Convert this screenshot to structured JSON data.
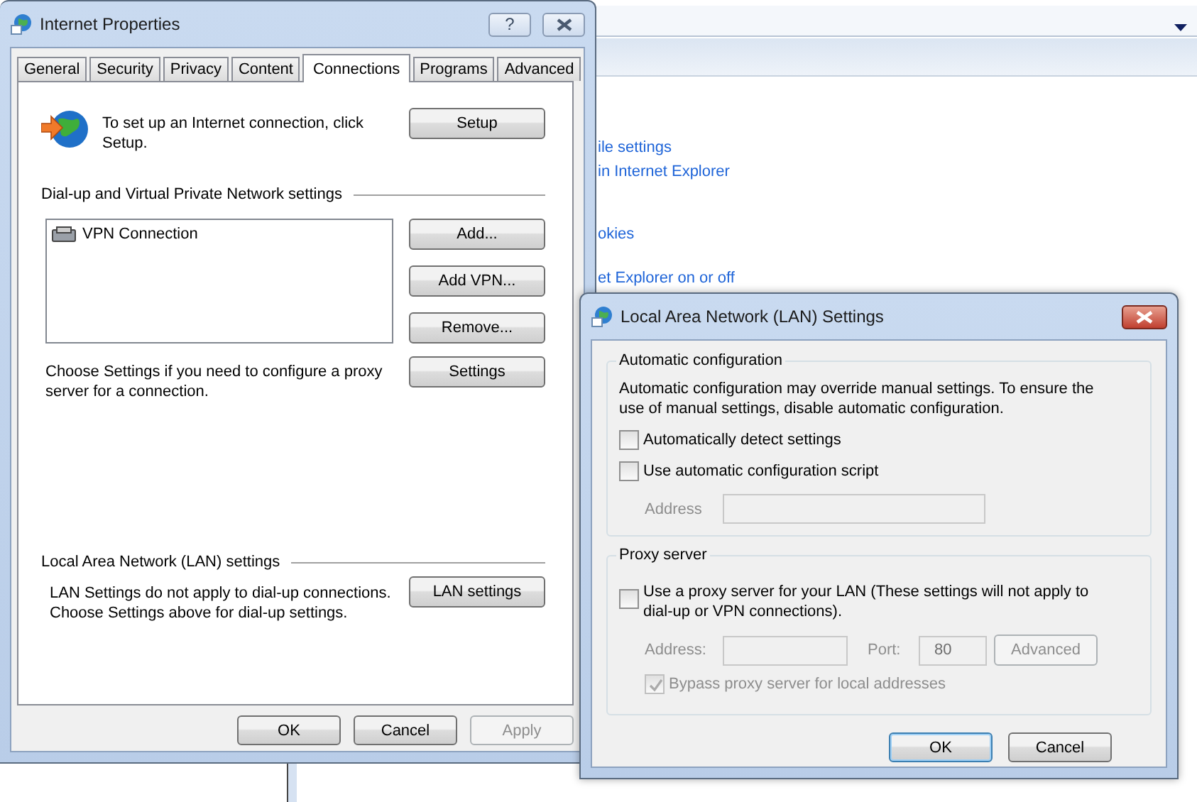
{
  "background_window": {
    "links": [
      "ile settings",
      "in Internet Explorer",
      "okies",
      "et Explorer on or off"
    ]
  },
  "internet_properties": {
    "title": "Internet Properties",
    "help_button": "?",
    "tabs": [
      {
        "label": "General",
        "selected": false
      },
      {
        "label": "Security",
        "selected": false
      },
      {
        "label": "Privacy",
        "selected": false
      },
      {
        "label": "Content",
        "selected": false
      },
      {
        "label": "Connections",
        "selected": true
      },
      {
        "label": "Programs",
        "selected": false
      },
      {
        "label": "Advanced",
        "selected": false
      }
    ],
    "setup_text": "To set up an Internet connection, click Setup.",
    "setup_button": "Setup",
    "vpn_heading": "Dial-up and Virtual Private Network settings",
    "connections": [
      "VPN Connection"
    ],
    "connection_buttons": [
      "Add...",
      "Add VPN...",
      "Remove..."
    ],
    "proxy_text": "Choose Settings if you need to configure a proxy server for a connection.",
    "settings_button": "Settings",
    "lan_heading": "Local Area Network (LAN) settings",
    "lan_text_lines": [
      "LAN Settings do not apply to dial-up connections.",
      "Choose Settings above for dial-up settings."
    ],
    "lan_button": "LAN settings",
    "buttons": [
      {
        "label": "OK",
        "disabled": false
      },
      {
        "label": "Cancel",
        "disabled": false
      },
      {
        "label": "Apply",
        "disabled": true
      }
    ]
  },
  "lan_dialog": {
    "title": "Local Area Network (LAN) Settings",
    "automatic": {
      "legend": "Automatic configuration",
      "description": "Automatic configuration may override manual settings.  To ensure the use of manual settings, disable automatic configuration.",
      "options": [
        {
          "label": "Automatically detect settings",
          "checked": false,
          "disabled": false
        },
        {
          "label": "Use automatic configuration script",
          "checked": false,
          "disabled": false
        }
      ],
      "address_label": "Address",
      "address_disabled": true
    },
    "proxy": {
      "legend": "Proxy server",
      "use_proxy": {
        "label": "Use a proxy server for your LAN (These settings will not apply to dial-up or VPN connections).",
        "checked": false,
        "disabled": false
      },
      "address_label": "Address:",
      "port_label": "Port:",
      "port_value": "80",
      "advanced_button": "Advanced",
      "fields_disabled": true,
      "bypass": {
        "label": "Bypass proxy server for local addresses",
        "checked": true,
        "disabled": true
      }
    },
    "buttons": [
      {
        "label": "OK",
        "default": true
      },
      {
        "label": "Cancel",
        "default": false
      }
    ]
  }
}
